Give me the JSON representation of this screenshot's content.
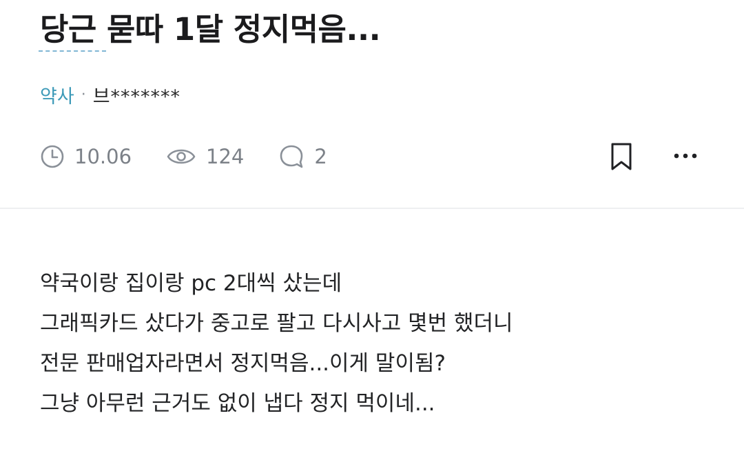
{
  "post": {
    "title": "당근 묻따 1달 정지먹음...",
    "board": "약사",
    "separator": "·",
    "author": "브*******",
    "stats": {
      "date": "10.06",
      "views": "124",
      "comments": "2"
    },
    "body_lines": [
      "약국이랑 집이랑 pc 2대씩 샀는데",
      "그래픽카드 샀다가 중고로 팔고 다시사고 몇번 했더니",
      "전문 판매업자라면서 정지먹음...이게 말이됨?",
      "그냥 아무런 근거도 없이 냅다 정지 먹이네..."
    ]
  },
  "icons": {
    "date": "clock-icon",
    "views": "eye-icon",
    "comments": "speech-bubble-icon",
    "bookmark": "bookmark-icon",
    "more": "more-dots-icon"
  },
  "colors": {
    "board_link": "#3d9ab8",
    "stat_text": "#7c8188",
    "title_text": "#1b1b1d",
    "divider": "#eeeff1"
  }
}
